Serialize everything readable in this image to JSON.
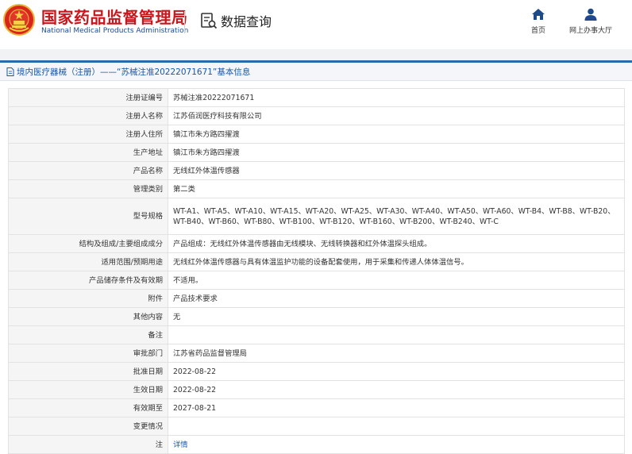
{
  "header": {
    "brand_cn": "国家药品监督管理局",
    "brand_en": "National Medical Products Administration",
    "query_label": "数据查询",
    "nav": [
      {
        "label": "首页",
        "icon": "home-icon"
      },
      {
        "label": "网上办事大厅",
        "icon": "user-icon"
      }
    ]
  },
  "title": "境内医疗器械（注册）——“苏械注准20222071671”基本信息",
  "rows": [
    {
      "label": "注册证编号",
      "value": "苏械注准20222071671"
    },
    {
      "label": "注册人名称",
      "value": "江苏佰润医疗科技有限公司"
    },
    {
      "label": "注册人住所",
      "value": "镇江市朱方路四擢渡"
    },
    {
      "label": "生产地址",
      "value": "镇江市朱方路四擢渡"
    },
    {
      "label": "产品名称",
      "value": "无线红外体温传感器"
    },
    {
      "label": "管理类别",
      "value": "第二类"
    },
    {
      "label": "型号规格",
      "value": "WT-A1、WT-A5、WT-A10、WT-A15、WT-A20、WT-A25、WT-A30、WT-A40、WT-A50、WT-A60、WT-B4、WT-B8、WT-B20、WT-B40、WT-B60、WT-B80、WT-B100、WT-B120、WT-B160、WT-B200、WT-B240、WT-C"
    },
    {
      "label": "结构及组成/主要组成成分",
      "value": "产品组成：无线红外体温传感器由无线模块、无线转换器和红外体温探头组成。"
    },
    {
      "label": "适用范围/预期用途",
      "value": "无线红外体温传感器与具有体温监护功能的设备配套使用，用于采集和传递人体体温信号。"
    },
    {
      "label": "产品储存条件及有效期",
      "value": "不适用。"
    },
    {
      "label": "附件",
      "value": "产品技术要求"
    },
    {
      "label": "其他内容",
      "value": "无"
    },
    {
      "label": "备注",
      "value": ""
    },
    {
      "label": "审批部门",
      "value": "江苏省药品监督管理局"
    },
    {
      "label": "批准日期",
      "value": "2022-08-22"
    },
    {
      "label": "生效日期",
      "value": "2022-08-22"
    },
    {
      "label": "有效期至",
      "value": "2027-08-21"
    },
    {
      "label": "变更情况",
      "value": ""
    },
    {
      "label": "注",
      "value": "详情"
    }
  ],
  "colors": {
    "brand_red": "#c8161d",
    "brand_blue": "#1e4a8a",
    "accent_blue": "#2a6bb0",
    "link_blue": "#1c55a3"
  }
}
